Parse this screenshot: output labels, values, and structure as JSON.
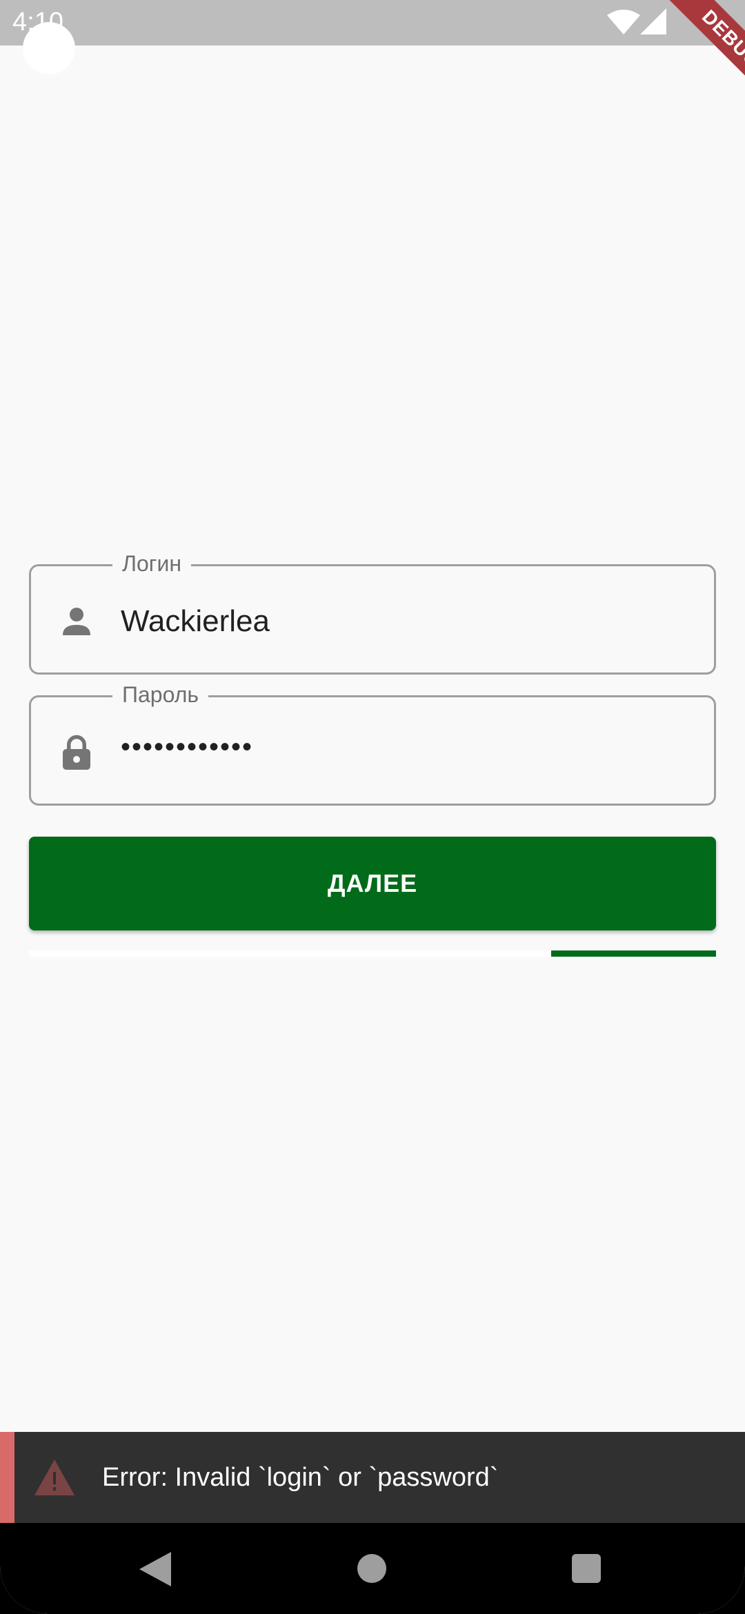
{
  "status_bar": {
    "time": "4:10",
    "debug_banner": "DEBUG"
  },
  "login_form": {
    "login_field": {
      "label": "Логин",
      "value": "Wackierlea",
      "icon": "person-icon"
    },
    "password_field": {
      "label": "Пароль",
      "value": "••••••••••••",
      "icon": "lock-icon"
    },
    "next_button_label": "ДАЛЕЕ",
    "progress": {
      "indeterminate": true,
      "visible_segment_start": 0.76,
      "visible_segment_end": 1.0
    }
  },
  "snackbar": {
    "icon": "warning-icon",
    "message": "Error: Invalid `login` or `password`"
  },
  "nav_bar": {
    "back": "back-icon",
    "home": "home-icon",
    "recents": "recents-icon"
  },
  "colors": {
    "primary": "#026b1a",
    "error_accent": "#d96a6a",
    "snackbar_bg": "#303030",
    "background": "#f9f9f9"
  }
}
